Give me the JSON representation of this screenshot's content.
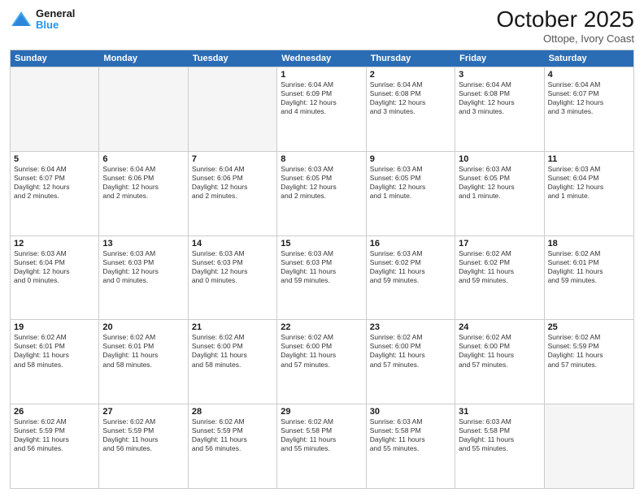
{
  "header": {
    "logo_line1": "General",
    "logo_line2": "Blue",
    "month": "October 2025",
    "location": "Ottope, Ivory Coast"
  },
  "day_headers": [
    "Sunday",
    "Monday",
    "Tuesday",
    "Wednesday",
    "Thursday",
    "Friday",
    "Saturday"
  ],
  "weeks": [
    [
      {
        "day": "",
        "info": ""
      },
      {
        "day": "",
        "info": ""
      },
      {
        "day": "",
        "info": ""
      },
      {
        "day": "1",
        "info": "Sunrise: 6:04 AM\nSunset: 6:09 PM\nDaylight: 12 hours\nand 4 minutes."
      },
      {
        "day": "2",
        "info": "Sunrise: 6:04 AM\nSunset: 6:08 PM\nDaylight: 12 hours\nand 3 minutes."
      },
      {
        "day": "3",
        "info": "Sunrise: 6:04 AM\nSunset: 6:08 PM\nDaylight: 12 hours\nand 3 minutes."
      },
      {
        "day": "4",
        "info": "Sunrise: 6:04 AM\nSunset: 6:07 PM\nDaylight: 12 hours\nand 3 minutes."
      }
    ],
    [
      {
        "day": "5",
        "info": "Sunrise: 6:04 AM\nSunset: 6:07 PM\nDaylight: 12 hours\nand 2 minutes."
      },
      {
        "day": "6",
        "info": "Sunrise: 6:04 AM\nSunset: 6:06 PM\nDaylight: 12 hours\nand 2 minutes."
      },
      {
        "day": "7",
        "info": "Sunrise: 6:04 AM\nSunset: 6:06 PM\nDaylight: 12 hours\nand 2 minutes."
      },
      {
        "day": "8",
        "info": "Sunrise: 6:03 AM\nSunset: 6:05 PM\nDaylight: 12 hours\nand 2 minutes."
      },
      {
        "day": "9",
        "info": "Sunrise: 6:03 AM\nSunset: 6:05 PM\nDaylight: 12 hours\nand 1 minute."
      },
      {
        "day": "10",
        "info": "Sunrise: 6:03 AM\nSunset: 6:05 PM\nDaylight: 12 hours\nand 1 minute."
      },
      {
        "day": "11",
        "info": "Sunrise: 6:03 AM\nSunset: 6:04 PM\nDaylight: 12 hours\nand 1 minute."
      }
    ],
    [
      {
        "day": "12",
        "info": "Sunrise: 6:03 AM\nSunset: 6:04 PM\nDaylight: 12 hours\nand 0 minutes."
      },
      {
        "day": "13",
        "info": "Sunrise: 6:03 AM\nSunset: 6:03 PM\nDaylight: 12 hours\nand 0 minutes."
      },
      {
        "day": "14",
        "info": "Sunrise: 6:03 AM\nSunset: 6:03 PM\nDaylight: 12 hours\nand 0 minutes."
      },
      {
        "day": "15",
        "info": "Sunrise: 6:03 AM\nSunset: 6:03 PM\nDaylight: 11 hours\nand 59 minutes."
      },
      {
        "day": "16",
        "info": "Sunrise: 6:03 AM\nSunset: 6:02 PM\nDaylight: 11 hours\nand 59 minutes."
      },
      {
        "day": "17",
        "info": "Sunrise: 6:02 AM\nSunset: 6:02 PM\nDaylight: 11 hours\nand 59 minutes."
      },
      {
        "day": "18",
        "info": "Sunrise: 6:02 AM\nSunset: 6:01 PM\nDaylight: 11 hours\nand 59 minutes."
      }
    ],
    [
      {
        "day": "19",
        "info": "Sunrise: 6:02 AM\nSunset: 6:01 PM\nDaylight: 11 hours\nand 58 minutes."
      },
      {
        "day": "20",
        "info": "Sunrise: 6:02 AM\nSunset: 6:01 PM\nDaylight: 11 hours\nand 58 minutes."
      },
      {
        "day": "21",
        "info": "Sunrise: 6:02 AM\nSunset: 6:00 PM\nDaylight: 11 hours\nand 58 minutes."
      },
      {
        "day": "22",
        "info": "Sunrise: 6:02 AM\nSunset: 6:00 PM\nDaylight: 11 hours\nand 57 minutes."
      },
      {
        "day": "23",
        "info": "Sunrise: 6:02 AM\nSunset: 6:00 PM\nDaylight: 11 hours\nand 57 minutes."
      },
      {
        "day": "24",
        "info": "Sunrise: 6:02 AM\nSunset: 6:00 PM\nDaylight: 11 hours\nand 57 minutes."
      },
      {
        "day": "25",
        "info": "Sunrise: 6:02 AM\nSunset: 5:59 PM\nDaylight: 11 hours\nand 57 minutes."
      }
    ],
    [
      {
        "day": "26",
        "info": "Sunrise: 6:02 AM\nSunset: 5:59 PM\nDaylight: 11 hours\nand 56 minutes."
      },
      {
        "day": "27",
        "info": "Sunrise: 6:02 AM\nSunset: 5:59 PM\nDaylight: 11 hours\nand 56 minutes."
      },
      {
        "day": "28",
        "info": "Sunrise: 6:02 AM\nSunset: 5:59 PM\nDaylight: 11 hours\nand 56 minutes."
      },
      {
        "day": "29",
        "info": "Sunrise: 6:02 AM\nSunset: 5:58 PM\nDaylight: 11 hours\nand 55 minutes."
      },
      {
        "day": "30",
        "info": "Sunrise: 6:03 AM\nSunset: 5:58 PM\nDaylight: 11 hours\nand 55 minutes."
      },
      {
        "day": "31",
        "info": "Sunrise: 6:03 AM\nSunset: 5:58 PM\nDaylight: 11 hours\nand 55 minutes."
      },
      {
        "day": "",
        "info": ""
      }
    ]
  ]
}
